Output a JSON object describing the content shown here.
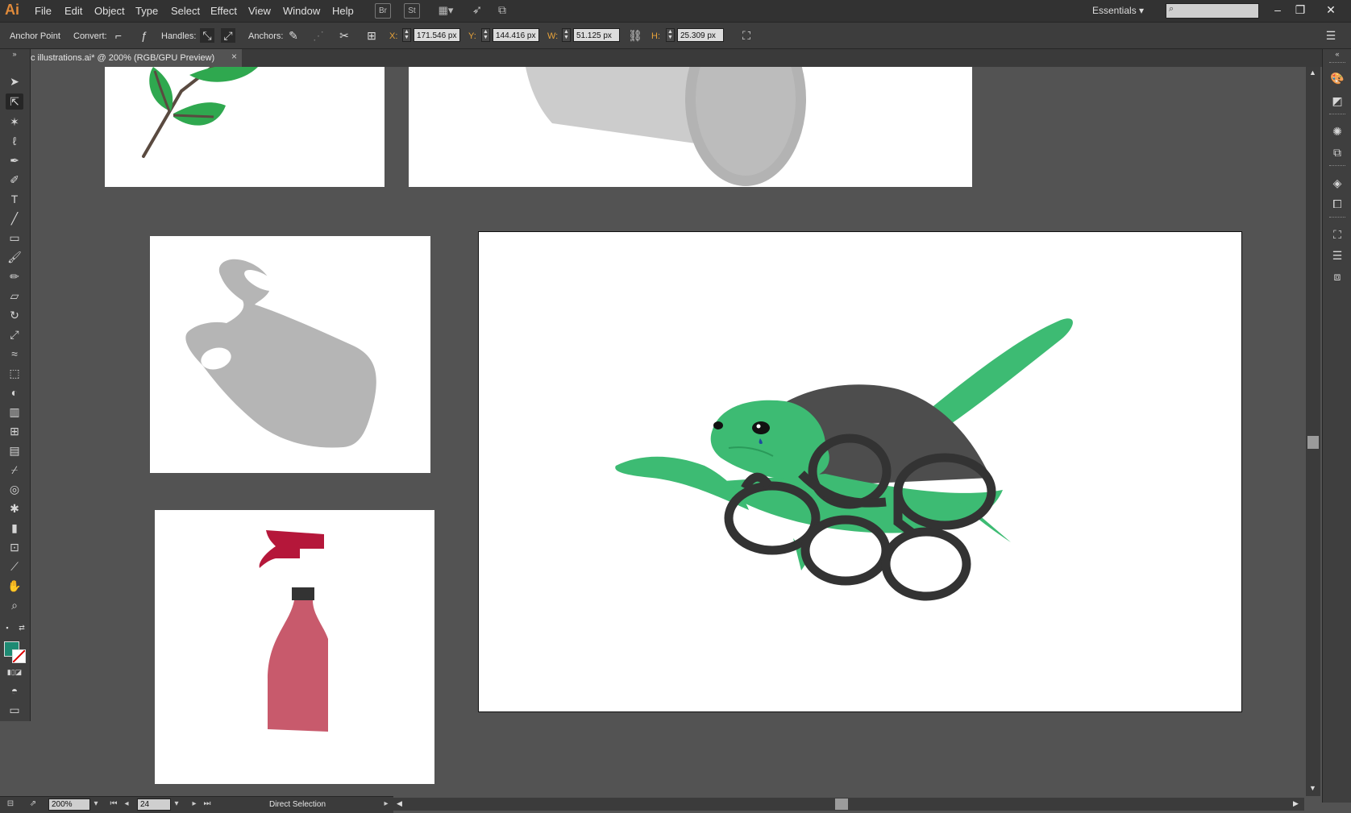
{
  "app": {
    "logo": "Ai"
  },
  "menubar": {
    "items": [
      "File",
      "Edit",
      "Object",
      "Type",
      "Select",
      "Effect",
      "View",
      "Window",
      "Help"
    ],
    "bridge_label": "Br",
    "stock_label": "St",
    "workspace": "Essentials"
  },
  "controlbar": {
    "title": "Anchor Point",
    "convert_label": "Convert:",
    "handles_label": "Handles:",
    "anchors_label": "Anchors:",
    "x_label": "X:",
    "x_value": "171.546 px",
    "y_label": "Y:",
    "y_value": "144.416 px",
    "w_label": "W:",
    "w_value": "51.125 px",
    "h_label": "H:",
    "h_value": "25.309 px"
  },
  "document": {
    "tab_title": "c illustrations.ai* @ 200% (RGB/GPU Preview)",
    "close_glyph": "×"
  },
  "statusbar": {
    "zoom": "200%",
    "artboard_number": "24",
    "current_tool": "Direct Selection"
  },
  "colors": {
    "fill": "#1e8a73",
    "accent": "#e08a3a",
    "turtle_green": "#3dbb73",
    "shell": "#4d4d4d",
    "rings": "#333333",
    "bottle_body": "#c85a6c",
    "bottle_trigger": "#b5173a",
    "bag_gray": "#b5b5b5",
    "leaf_green": "#2fa84f"
  },
  "artboards": [
    {
      "name": "plant-sprig"
    },
    {
      "name": "plastic-cup"
    },
    {
      "name": "plastic-bag"
    },
    {
      "name": "spray-bottle"
    },
    {
      "name": "turtle-six-pack-rings"
    }
  ]
}
